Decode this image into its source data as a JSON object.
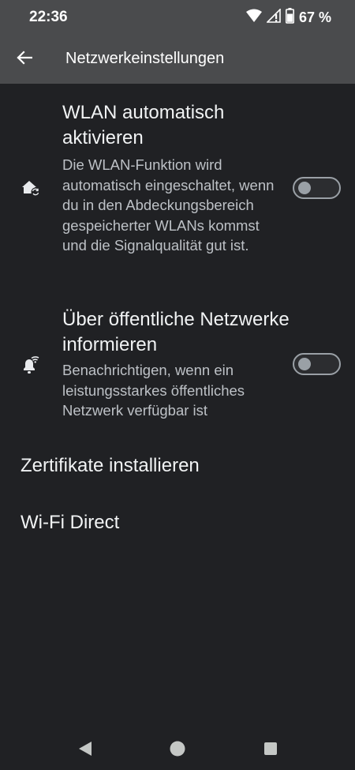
{
  "status_bar": {
    "time": "22:36",
    "battery_percent": "67 %",
    "icons": [
      "wifi-icon",
      "cellular-signal-icon",
      "battery-icon"
    ]
  },
  "app_bar": {
    "title": "Netzwerkeinstellungen",
    "back_icon": "arrow-back-icon"
  },
  "settings": [
    {
      "icon": "home-wifi-sync-icon",
      "title": "WLAN automatisch aktivieren",
      "summary": "Die WLAN-Funktion wird automatisch eingeschaltet, wenn du in den Abdeckungs­bereich gespeicherter WLANs kommst und die Signalqualität gut ist.",
      "enabled": false
    },
    {
      "icon": "notification-wifi-icon",
      "title": "Über öffentliche Netzwerke informieren",
      "summary": "Benachrichtigen, wenn ein leistungsstarkes öffentliches Netzwerk verfügbar ist",
      "enabled": false
    }
  ],
  "items": [
    {
      "label": "Zertifikate installieren"
    },
    {
      "label": "Wi-Fi Direct"
    }
  ],
  "nav_bar": {
    "buttons": [
      "back-triangle-icon",
      "home-circle-icon",
      "recents-square-icon"
    ]
  },
  "colors": {
    "background": "#202124",
    "app_bar": "#4a4b4d",
    "toggle_off": "#9aa0a6"
  }
}
